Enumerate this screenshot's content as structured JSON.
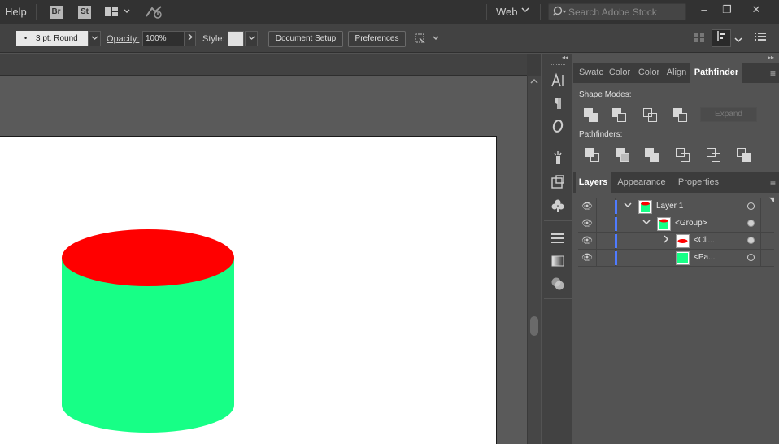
{
  "menubar": {
    "help": "Help",
    "bridge_badge": "Br",
    "stock_badge": "St",
    "arrange_icon": "arrange-documents-icon",
    "gpu_icon": "gpu-performance-icon",
    "workspace": "Web",
    "search_placeholder": "Search Adobe Stock",
    "window_minimize": "–",
    "window_restore": "❐",
    "window_close": "✕"
  },
  "controlbar": {
    "stroke_profile": "3 pt. Round",
    "opacity_label": "Opacity:",
    "opacity_value": "100%",
    "style_label": "Style:",
    "document_setup": "Document Setup",
    "preferences": "Preferences"
  },
  "artwork": {
    "top_color": "#ff0000",
    "body_color": "#17ff86"
  },
  "panels": {
    "top_tabs": [
      "Swatc",
      "Color",
      "Color",
      "Align",
      "Pathfinder"
    ],
    "active_top_tab": "Pathfinder",
    "shape_modes_label": "Shape Modes:",
    "pathfinders_label": "Pathfinders:",
    "expand_label": "Expand",
    "bottom_tabs": [
      "Layers",
      "Appearance",
      "Properties"
    ],
    "active_bottom_tab": "Layers"
  },
  "layers": [
    {
      "name": "Layer 1",
      "expanded": true,
      "target": "open"
    },
    {
      "name": "<Group>",
      "expanded": true,
      "target": "filled"
    },
    {
      "name": "<Cli...",
      "expanded": false,
      "target": "filled"
    },
    {
      "name": "<Pa...",
      "expanded": null,
      "target": "open"
    }
  ]
}
